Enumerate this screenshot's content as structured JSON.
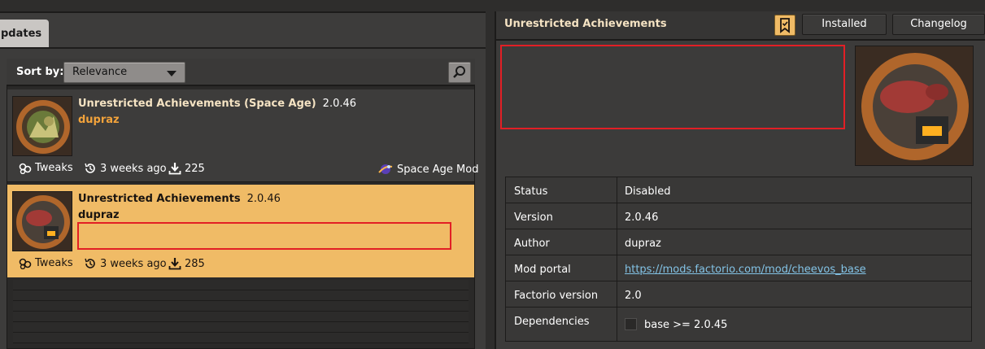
{
  "left_panel": {
    "tab_label": "pdates",
    "sort_label": "Sort by:",
    "sort_value": "Relevance",
    "mods": [
      {
        "title": "Unrestricted Achievements (Space Age)",
        "version": "2.0.46",
        "author": "dupraz",
        "category": "Tweaks",
        "updated": "3 weeks ago",
        "downloads": "225",
        "badge": "Space Age Mod",
        "selected": false
      },
      {
        "title": "Unrestricted Achievements",
        "version": "2.0.46",
        "author": "dupraz",
        "category": "Tweaks",
        "updated": "3 weeks ago",
        "downloads": "285",
        "selected": true
      }
    ]
  },
  "right_panel": {
    "title": "Unrestricted Achievements",
    "installed_button": "Installed",
    "changelog_button": "Changelog",
    "info": {
      "status_key": "Status",
      "status_val": "Disabled",
      "version_key": "Version",
      "version_val": "2.0.46",
      "author_key": "Author",
      "author_val": "dupraz",
      "portal_key": "Mod portal",
      "portal_val": "https://mods.factorio.com/mod/cheevos_base",
      "factorio_key": "Factorio version",
      "factorio_val": "2.0",
      "deps_key": "Dependencies",
      "deps_val": "base >= 2.0.45"
    }
  },
  "colors": {
    "accent_orange": "#f0bb66",
    "author_orange": "#f3a33b",
    "highlight_red": "#e21f25",
    "link_blue": "#83c3e6"
  },
  "icons": [
    "search-icon",
    "tweaks-icon",
    "history-icon",
    "download-icon",
    "space-age-icon",
    "bookmark-icon"
  ]
}
